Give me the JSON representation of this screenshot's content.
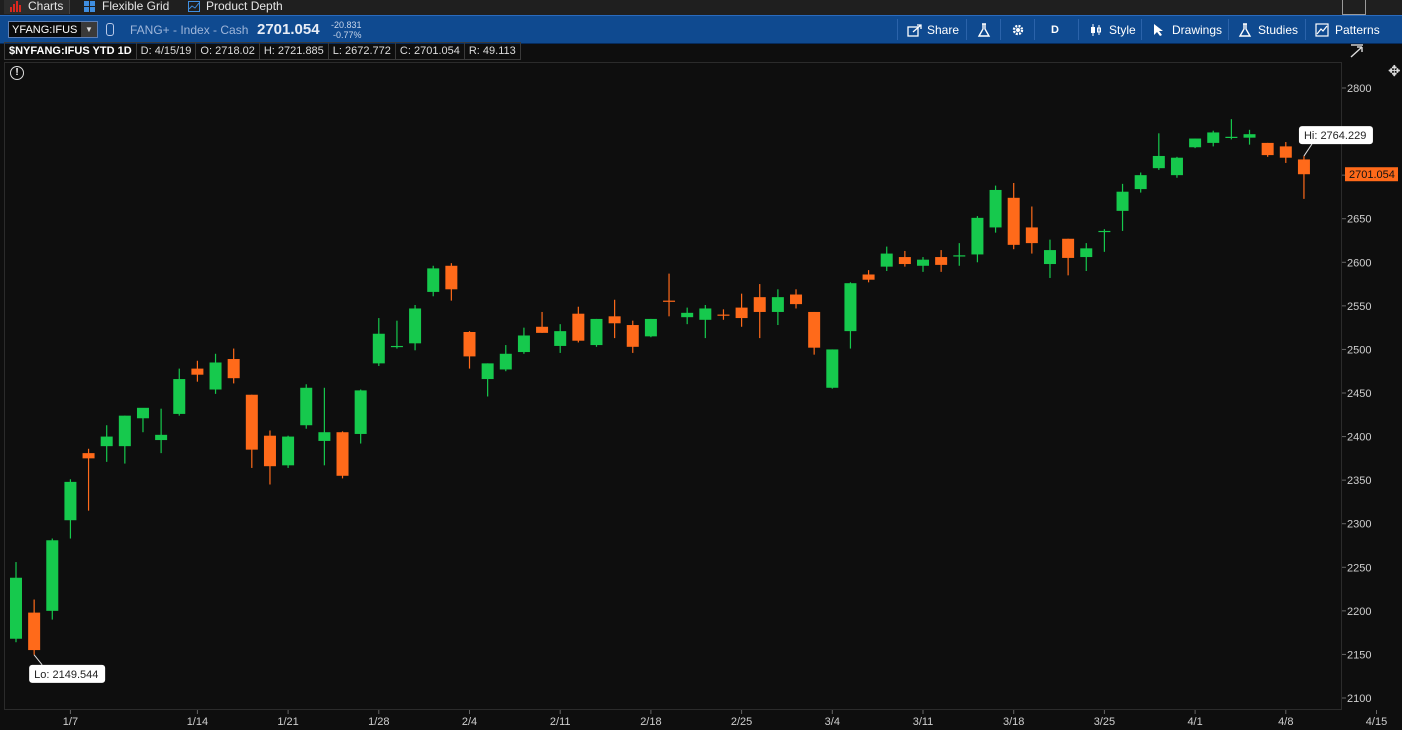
{
  "tabs": [
    {
      "label": "Charts",
      "icon": "bar-chart-icon"
    },
    {
      "label": "Flexible Grid",
      "icon": "grid-icon"
    },
    {
      "label": "Product Depth",
      "icon": "depth-chart-icon"
    }
  ],
  "toolbar": {
    "symbol": "YFANG:IFUS",
    "description": "FANG+ - Index - Cash",
    "price": "2701.054",
    "change": "-20.831",
    "change_pct": "-0.77%",
    "share_label": "Share",
    "period_label": "D",
    "style_label": "Style",
    "drawings_label": "Drawings",
    "studies_label": "Studies",
    "patterns_label": "Patterns"
  },
  "info": {
    "symbol_period": "$NYFANG:IFUS YTD 1D",
    "date": "D: 4/15/19",
    "open": "O: 2718.02",
    "high": "H: 2721.885",
    "low": "L: 2672.772",
    "close": "C: 2701.054",
    "range": "R: 49.113"
  },
  "colors": {
    "up": "#16c94d",
    "down": "#ff6a1a",
    "last_price_bg": "#ff6a1a",
    "background": "#111111"
  },
  "chart_data": {
    "type": "candlestick",
    "y_ticks": [
      "2800",
      "2750",
      "2700",
      "2650",
      "2600",
      "2550",
      "2500",
      "2450",
      "2400",
      "2350",
      "2300",
      "2250",
      "2200",
      "2150",
      "2100"
    ],
    "x_labels": [
      "1/7",
      "1/14",
      "1/21",
      "1/28",
      "2/4",
      "2/11",
      "2/18",
      "2/25",
      "3/4",
      "3/11",
      "3/18",
      "3/25",
      "4/1",
      "4/8",
      "4/15"
    ],
    "x_label_index": [
      3,
      10,
      15,
      20,
      25,
      30,
      35,
      40,
      45,
      50,
      55,
      60,
      65,
      70,
      75
    ],
    "ylim": [
      2090,
      2825
    ],
    "last_price_label": "2701.054",
    "hi_label": "Hi: 2764.229",
    "lo_label": "Lo: 2149.544",
    "hi_index": 71,
    "lo_index": 1,
    "candles": [
      {
        "o": 2168,
        "h": 2256,
        "l": 2164,
        "c": 2238
      },
      {
        "o": 2198,
        "h": 2213,
        "l": 2149.544,
        "c": 2155
      },
      {
        "o": 2200,
        "h": 2283,
        "l": 2190,
        "c": 2281
      },
      {
        "o": 2304,
        "h": 2351,
        "l": 2283,
        "c": 2348
      },
      {
        "o": 2381,
        "h": 2386,
        "l": 2315,
        "c": 2375
      },
      {
        "o": 2389,
        "h": 2413,
        "l": 2371,
        "c": 2400
      },
      {
        "o": 2389,
        "h": 2424,
        "l": 2369,
        "c": 2424
      },
      {
        "o": 2421,
        "h": 2432,
        "l": 2405,
        "c": 2433
      },
      {
        "o": 2396,
        "h": 2432,
        "l": 2381,
        "c": 2402
      },
      {
        "o": 2426,
        "h": 2478,
        "l": 2424,
        "c": 2466
      },
      {
        "o": 2478,
        "h": 2487,
        "l": 2463,
        "c": 2471
      },
      {
        "o": 2454,
        "h": 2495,
        "l": 2449,
        "c": 2485
      },
      {
        "o": 2489,
        "h": 2501,
        "l": 2461,
        "c": 2467
      },
      {
        "o": 2448,
        "h": 2448,
        "l": 2364,
        "c": 2385
      },
      {
        "o": 2401,
        "h": 2407,
        "l": 2345,
        "c": 2366
      },
      {
        "o": 2367,
        "h": 2401,
        "l": 2364,
        "c": 2400
      },
      {
        "o": 2413,
        "h": 2460,
        "l": 2409,
        "c": 2456
      },
      {
        "o": 2395,
        "h": 2456,
        "l": 2367,
        "c": 2405
      },
      {
        "o": 2405,
        "h": 2406,
        "l": 2352,
        "c": 2355
      },
      {
        "o": 2403,
        "h": 2454,
        "l": 2392,
        "c": 2453
      },
      {
        "o": 2484,
        "h": 2536,
        "l": 2481,
        "c": 2518
      },
      {
        "o": 2504,
        "h": 2533,
        "l": 2501,
        "c": 2504
      },
      {
        "o": 2507,
        "h": 2551,
        "l": 2499,
        "c": 2547
      },
      {
        "o": 2566,
        "h": 2596,
        "l": 2561,
        "c": 2593
      },
      {
        "o": 2596,
        "h": 2599,
        "l": 2556,
        "c": 2569
      },
      {
        "o": 2520,
        "h": 2521,
        "l": 2478,
        "c": 2492
      },
      {
        "o": 2466,
        "h": 2484,
        "l": 2446,
        "c": 2484
      },
      {
        "o": 2477,
        "h": 2505,
        "l": 2475,
        "c": 2495
      },
      {
        "o": 2497,
        "h": 2525,
        "l": 2495,
        "c": 2516
      },
      {
        "o": 2526,
        "h": 2543,
        "l": 2519,
        "c": 2519
      },
      {
        "o": 2504,
        "h": 2529,
        "l": 2496,
        "c": 2521
      },
      {
        "o": 2541,
        "h": 2549,
        "l": 2508,
        "c": 2510
      },
      {
        "o": 2505,
        "h": 2535,
        "l": 2503,
        "c": 2535
      },
      {
        "o": 2538,
        "h": 2557,
        "l": 2513,
        "c": 2530
      },
      {
        "o": 2528,
        "h": 2533,
        "l": 2496,
        "c": 2503
      },
      {
        "o": 2515,
        "h": 2535,
        "l": 2514,
        "c": 2535
      },
      {
        "o": 2556,
        "h": 2587,
        "l": 2538,
        "c": 2555
      },
      {
        "o": 2537,
        "h": 2548,
        "l": 2529,
        "c": 2542
      },
      {
        "o": 2534,
        "h": 2551,
        "l": 2513,
        "c": 2547
      },
      {
        "o": 2540,
        "h": 2546,
        "l": 2534,
        "c": 2539
      },
      {
        "o": 2548,
        "h": 2564,
        "l": 2526,
        "c": 2536
      },
      {
        "o": 2560,
        "h": 2575,
        "l": 2513,
        "c": 2543
      },
      {
        "o": 2543,
        "h": 2569,
        "l": 2528,
        "c": 2560
      },
      {
        "o": 2563,
        "h": 2569,
        "l": 2547,
        "c": 2552
      },
      {
        "o": 2543,
        "h": 2543,
        "l": 2494,
        "c": 2502
      },
      {
        "o": 2456,
        "h": 2500,
        "l": 2455,
        "c": 2500
      },
      {
        "o": 2521,
        "h": 2577,
        "l": 2501,
        "c": 2576
      },
      {
        "o": 2586,
        "h": 2591,
        "l": 2577,
        "c": 2580
      },
      {
        "o": 2595,
        "h": 2618,
        "l": 2590,
        "c": 2610
      },
      {
        "o": 2606,
        "h": 2613,
        "l": 2595,
        "c": 2598
      },
      {
        "o": 2596,
        "h": 2606,
        "l": 2589,
        "c": 2603
      },
      {
        "o": 2606,
        "h": 2614,
        "l": 2589,
        "c": 2597
      },
      {
        "o": 2608,
        "h": 2622,
        "l": 2596,
        "c": 2608
      },
      {
        "o": 2609,
        "h": 2653,
        "l": 2600,
        "c": 2651
      },
      {
        "o": 2640,
        "h": 2688,
        "l": 2634,
        "c": 2683
      },
      {
        "o": 2674,
        "h": 2691,
        "l": 2615,
        "c": 2620
      },
      {
        "o": 2640,
        "h": 2664,
        "l": 2610,
        "c": 2622
      },
      {
        "o": 2598,
        "h": 2626,
        "l": 2582,
        "c": 2614
      },
      {
        "o": 2627,
        "h": 2627,
        "l": 2585,
        "c": 2605
      },
      {
        "o": 2606,
        "h": 2622,
        "l": 2590,
        "c": 2616
      },
      {
        "o": 2636,
        "h": 2638,
        "l": 2612,
        "c": 2636
      },
      {
        "o": 2659,
        "h": 2690,
        "l": 2636,
        "c": 2681
      },
      {
        "o": 2684,
        "h": 2703,
        "l": 2680,
        "c": 2700
      },
      {
        "o": 2708,
        "h": 2748,
        "l": 2706,
        "c": 2722
      },
      {
        "o": 2700,
        "h": 2721,
        "l": 2697,
        "c": 2720
      },
      {
        "o": 2732,
        "h": 2742,
        "l": 2731,
        "c": 2742
      },
      {
        "o": 2737,
        "h": 2751,
        "l": 2733,
        "c": 2749
      },
      {
        "o": 2744,
        "h": 2764.229,
        "l": 2741,
        "c": 2744
      },
      {
        "o": 2743,
        "h": 2752,
        "l": 2735,
        "c": 2747
      },
      {
        "o": 2737,
        "h": 2737,
        "l": 2721,
        "c": 2723
      },
      {
        "o": 2733,
        "h": 2738,
        "l": 2714,
        "c": 2720
      },
      {
        "o": 2718.02,
        "h": 2721.885,
        "l": 2672.772,
        "c": 2701.054
      }
    ]
  }
}
